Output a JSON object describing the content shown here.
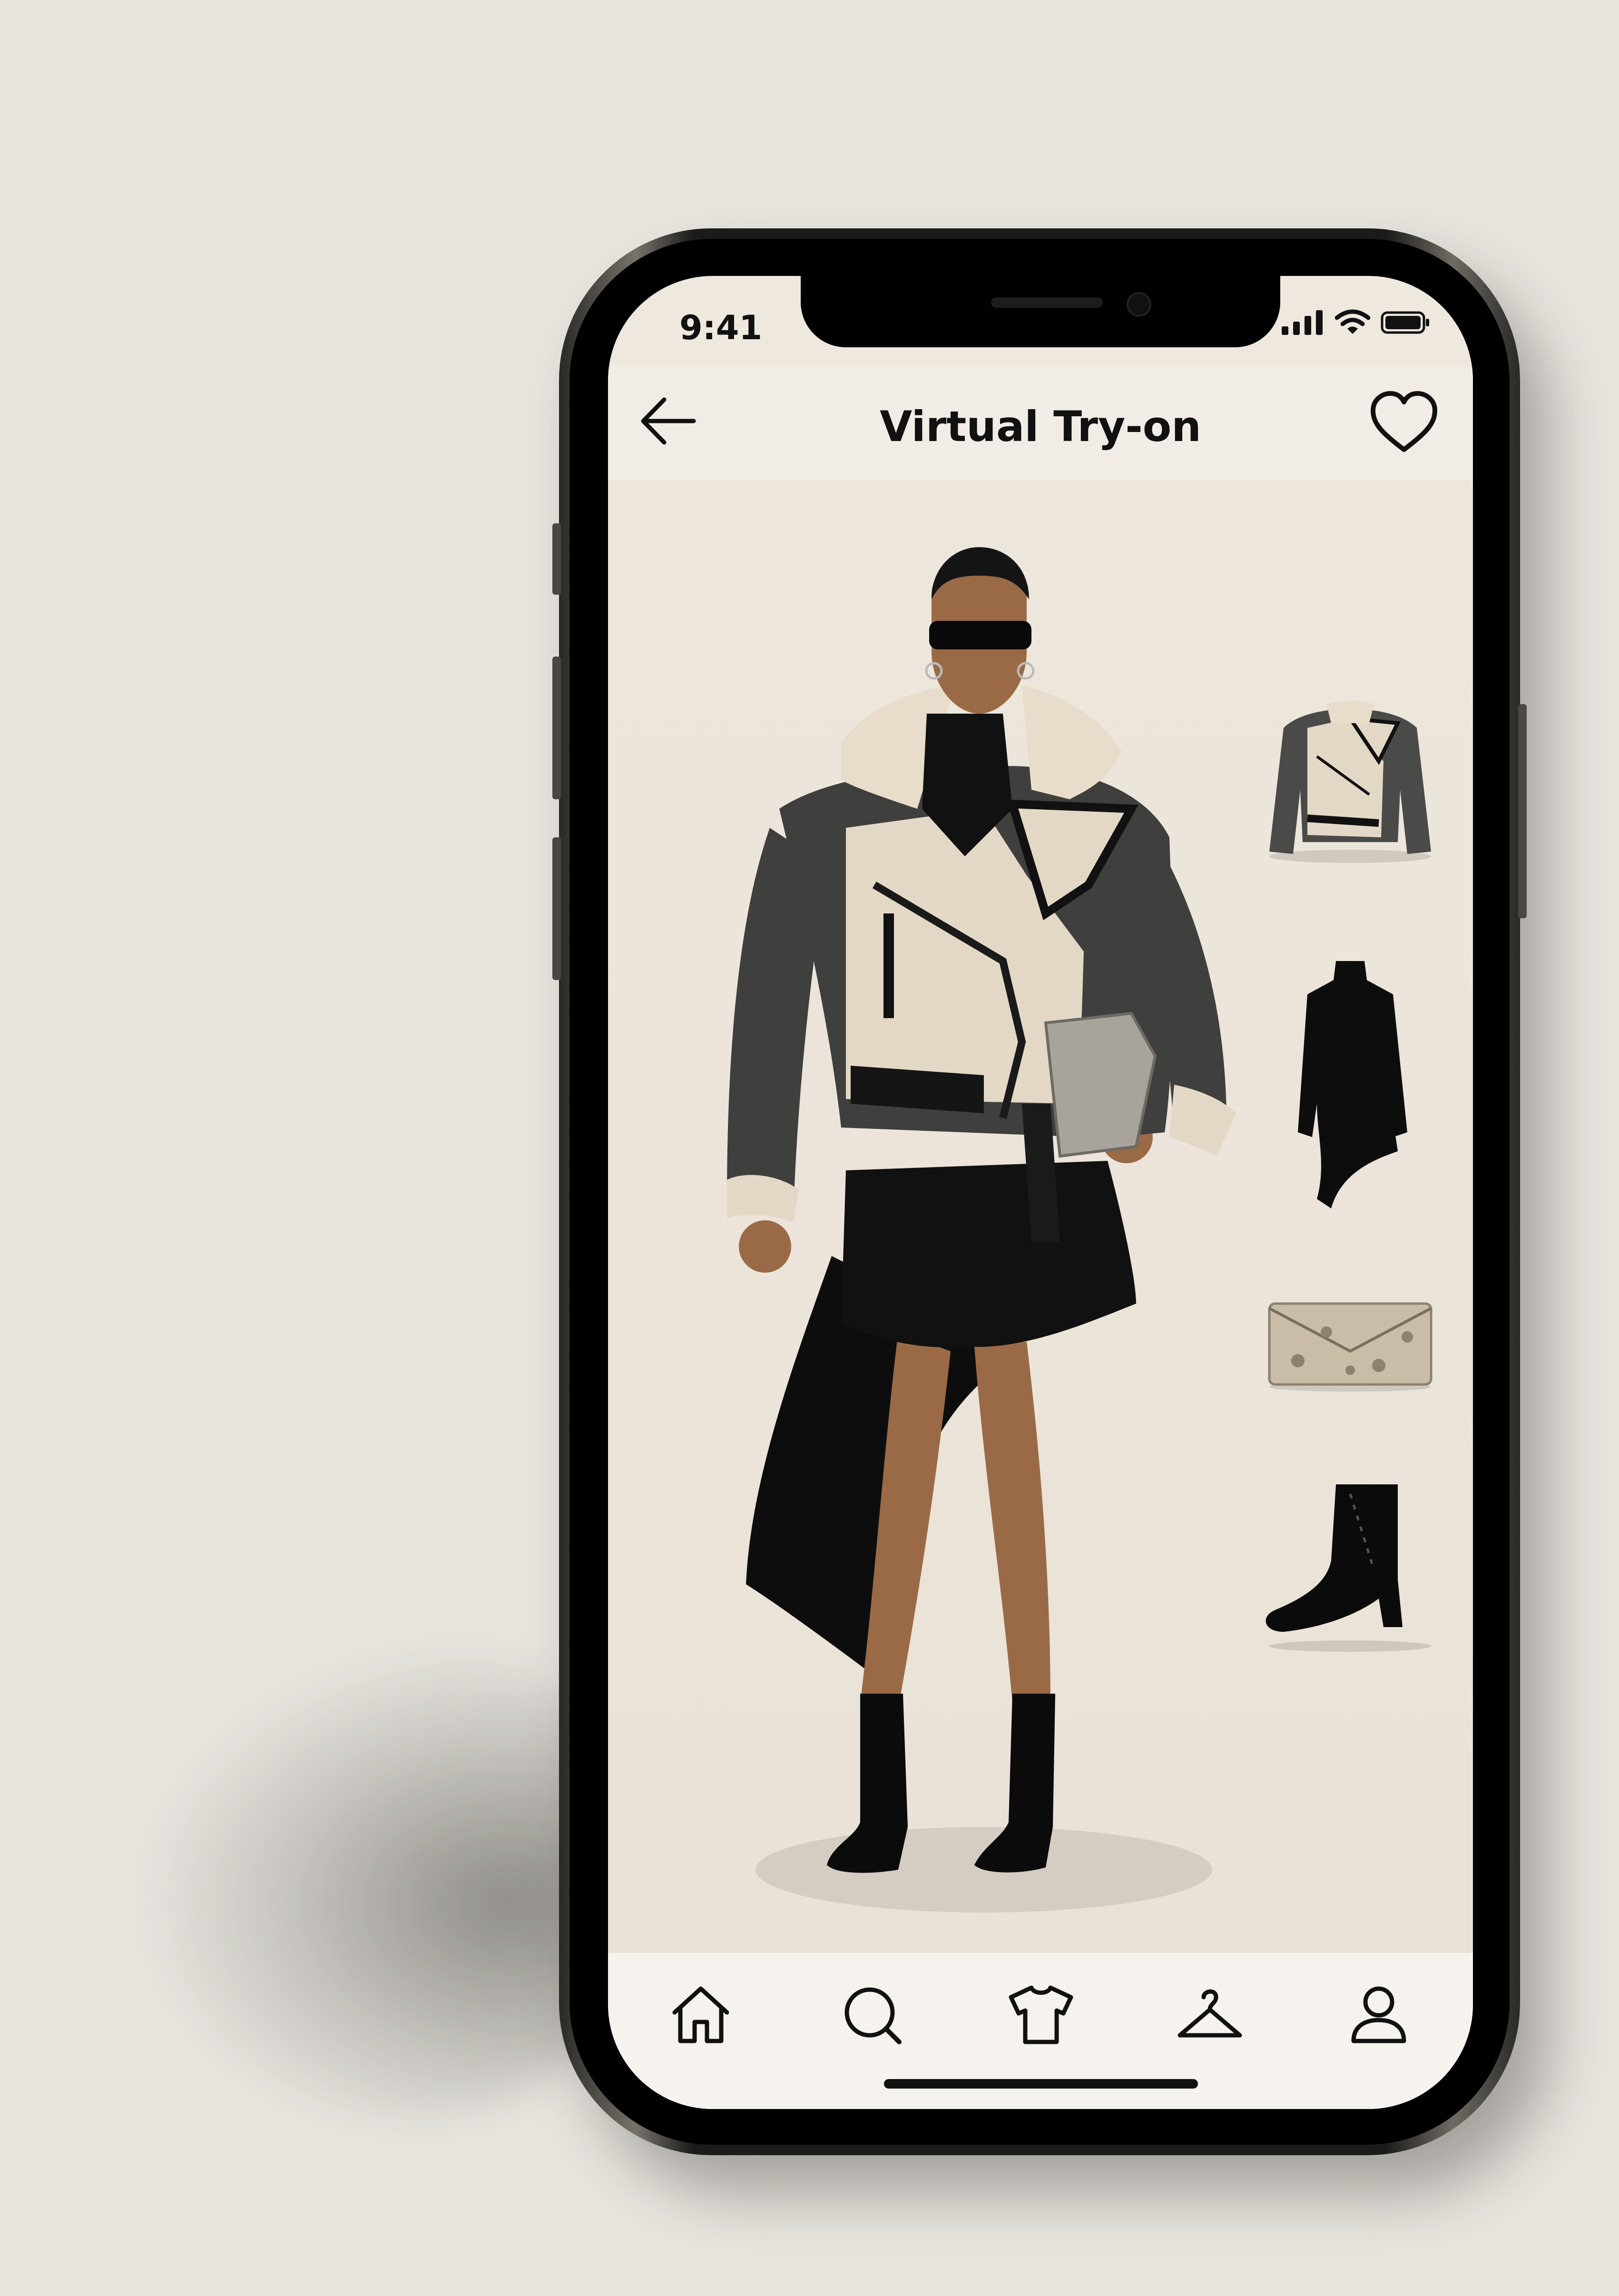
{
  "status_bar": {
    "time": "9:41"
  },
  "header": {
    "title": "Virtual Try-on"
  },
  "outfit_items": [
    {
      "name": "shearling-jacket"
    },
    {
      "name": "black-ruffle-dress"
    },
    {
      "name": "snakeskin-clutch"
    },
    {
      "name": "black-lace-up-boot"
    }
  ],
  "tab_bar": {
    "tabs": [
      {
        "icon": "home-icon"
      },
      {
        "icon": "search-icon"
      },
      {
        "icon": "shirt-icon"
      },
      {
        "icon": "hanger-icon"
      },
      {
        "icon": "profile-icon"
      }
    ]
  },
  "colors": {
    "background": "#e8e5df",
    "screen": "#efe8de",
    "text": "#111111"
  }
}
